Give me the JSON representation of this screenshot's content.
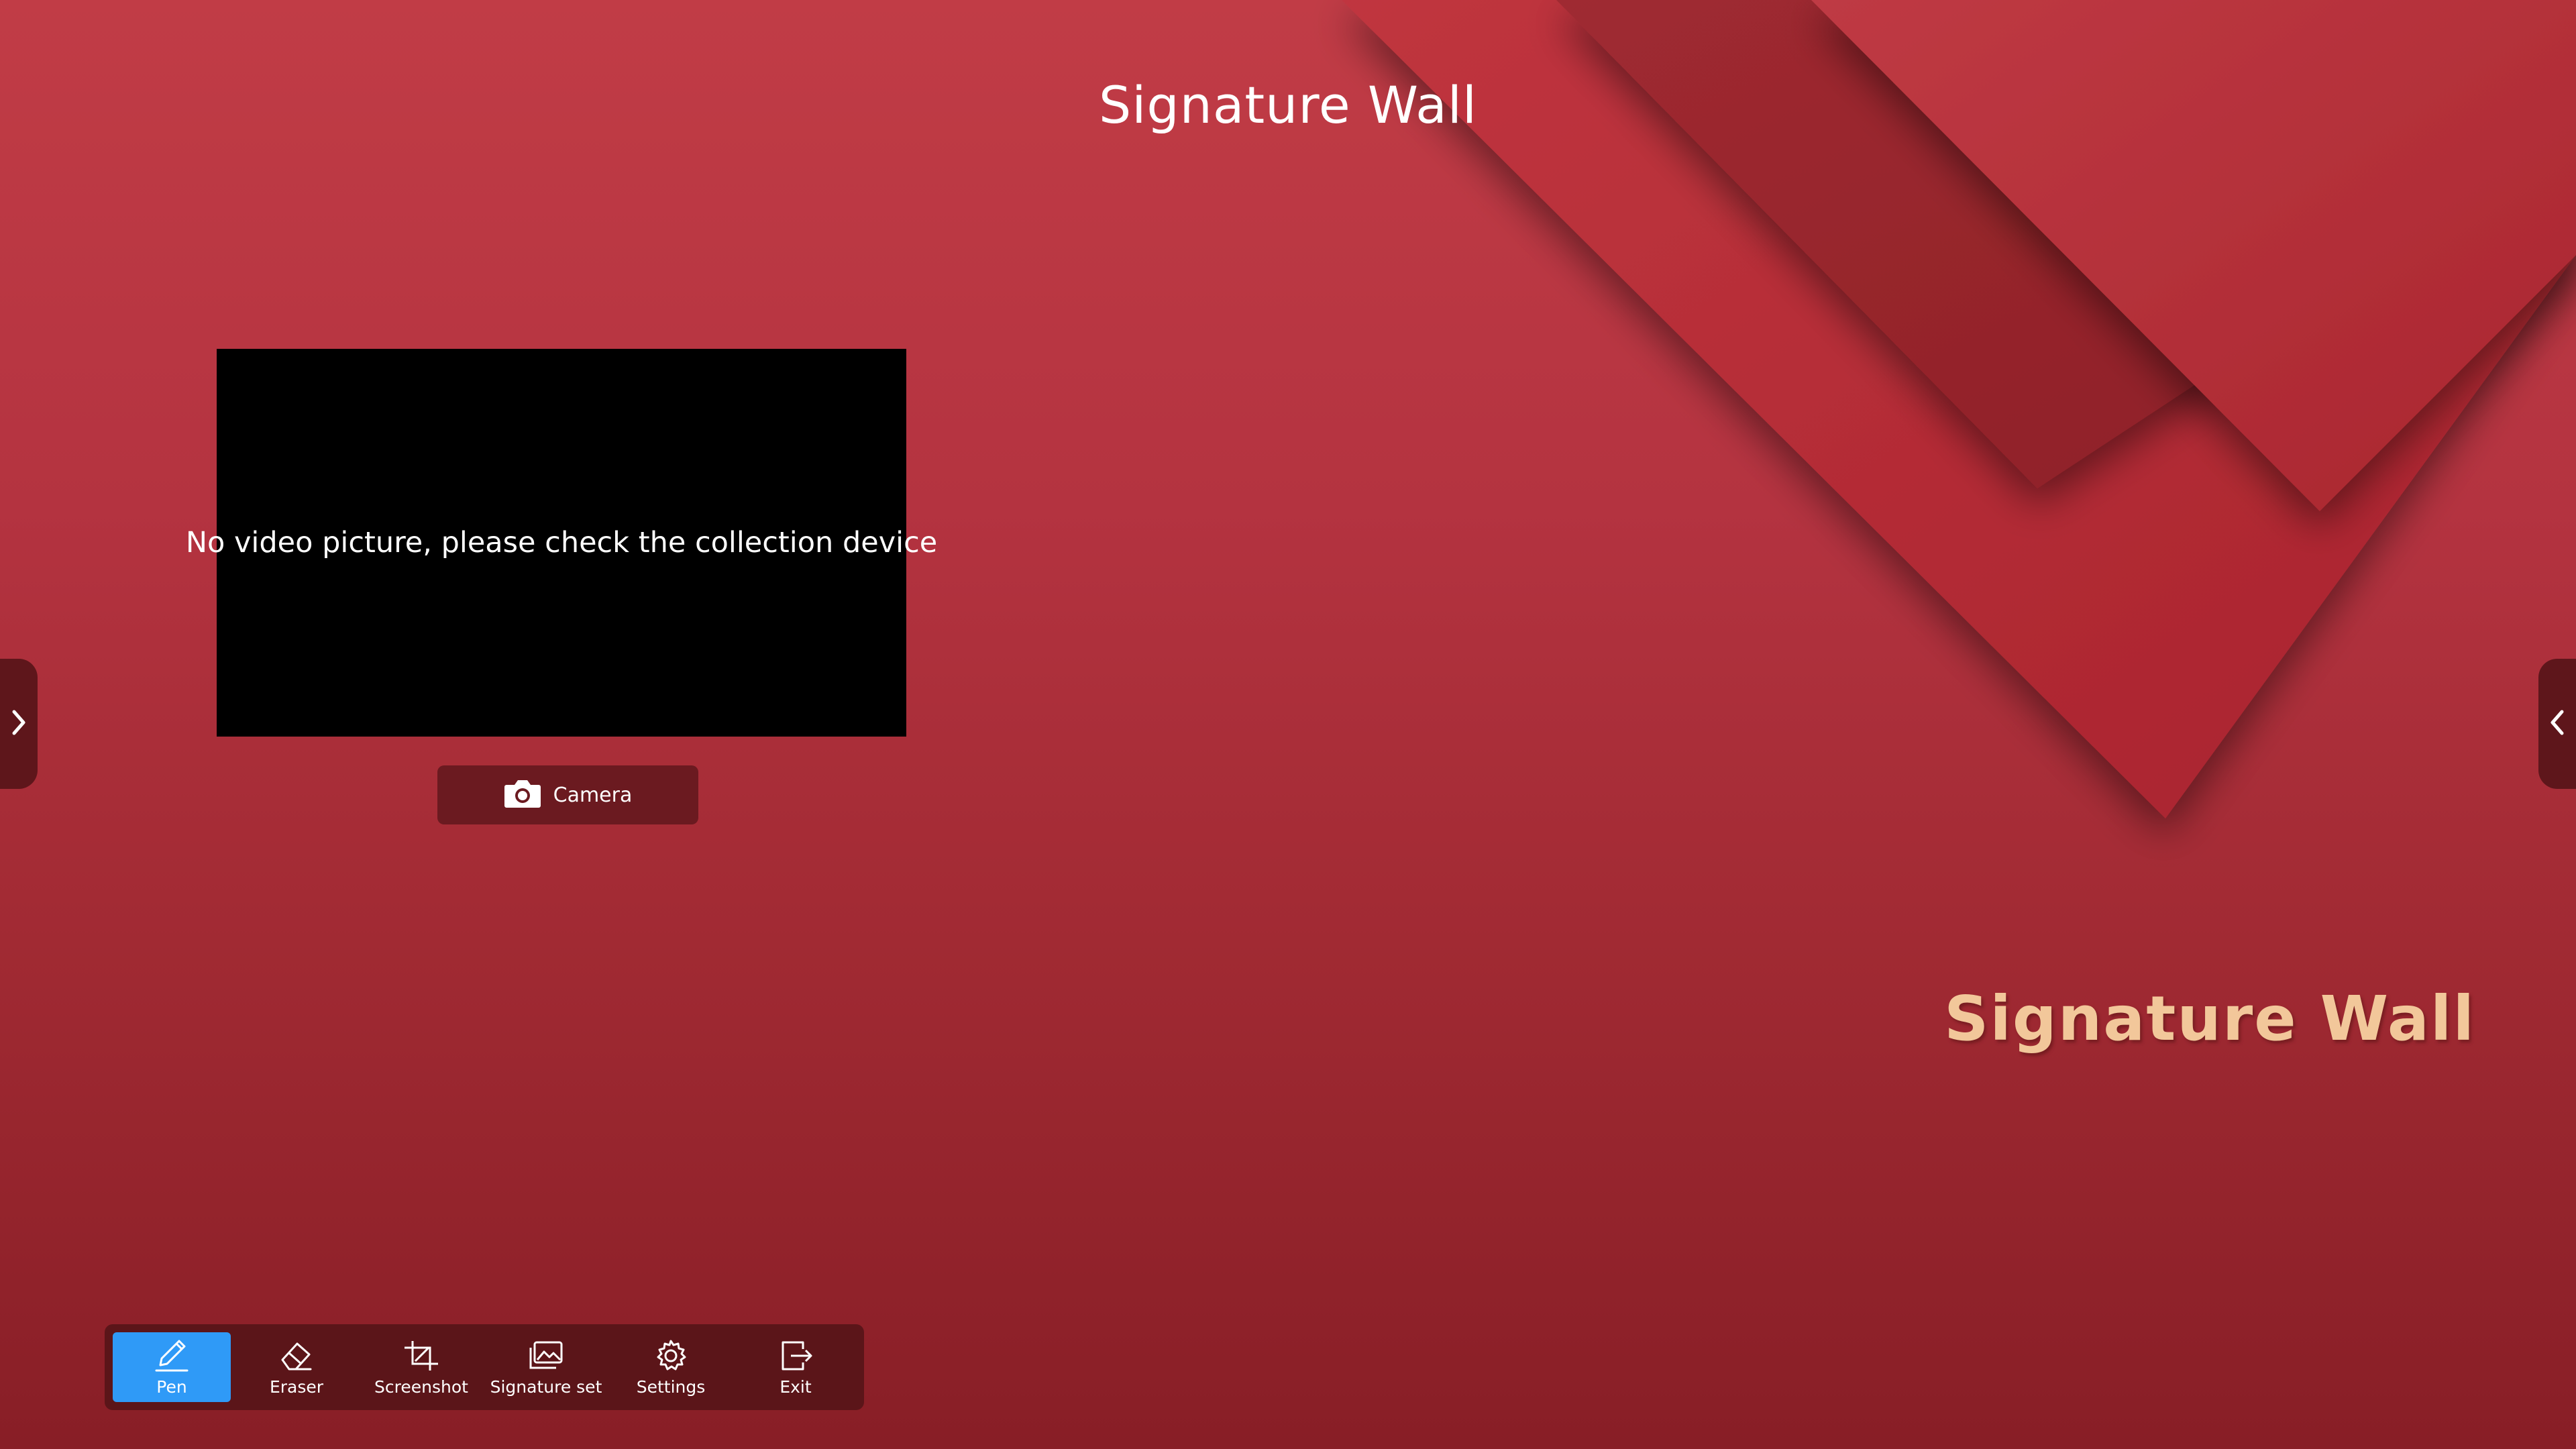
{
  "app": {
    "title": "Signature Wall",
    "brand_text": "Signature Wall"
  },
  "video": {
    "message": "No video picture, please check the collection device"
  },
  "camera_button": {
    "label": "Camera",
    "icon": "camera-icon"
  },
  "side_handles": {
    "left_icon": "chevron-right-icon",
    "right_icon": "chevron-left-icon"
  },
  "toolbar": {
    "items": [
      {
        "label": "Pen",
        "icon": "pen-icon",
        "active": true
      },
      {
        "label": "Eraser",
        "icon": "eraser-icon",
        "active": false
      },
      {
        "label": "Screenshot",
        "icon": "crop-icon",
        "active": false
      },
      {
        "label": "Signature set",
        "icon": "images-icon",
        "active": false
      },
      {
        "label": "Settings",
        "icon": "gear-icon",
        "active": false
      },
      {
        "label": "Exit",
        "icon": "exit-icon",
        "active": false
      }
    ]
  },
  "colors": {
    "background_top": "#c13c46",
    "background_bottom": "#881e26",
    "brand_text": "#f2c79a",
    "toolbar_bg": "#5b1519",
    "active_tool": "#2f9af7",
    "camera_button_bg": "#6b1a20"
  }
}
